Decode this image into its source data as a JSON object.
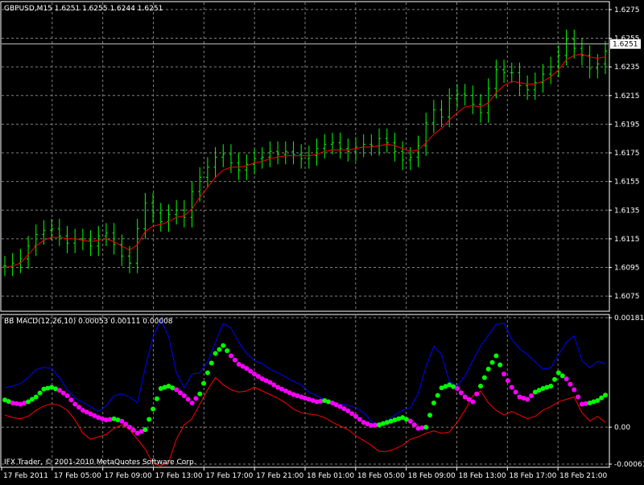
{
  "chart_data": [
    {
      "type": "candlestick",
      "title": "GBPUSD,M15  1.6251 1.6255 1.6244 1.6251",
      "current_price": 1.6251,
      "current_price_label": "1.6251",
      "ylim": [
        1.6065,
        1.628
      ],
      "y_ticks": [
        1.6275,
        1.6255,
        1.6235,
        1.6215,
        1.6195,
        1.6175,
        1.6155,
        1.6135,
        1.6115,
        1.6095,
        1.6075
      ],
      "y_tick_labels": [
        "1.6275",
        "1.6255",
        "1.6235",
        "1.6215",
        "1.6195",
        "1.6175",
        "1.6155",
        "1.6135",
        "1.6115",
        "1.6095",
        "1.6075"
      ],
      "grid": true,
      "series": [
        {
          "name": "Close",
          "color": "#00ff00",
          "values": [
            1.6096,
            1.6098,
            1.6101,
            1.611,
            1.6118,
            1.6121,
            1.6122,
            1.6117,
            1.6112,
            1.6115,
            1.6114,
            1.611,
            1.6117,
            1.6119,
            1.6111,
            1.6103,
            1.6098,
            1.6122,
            1.614,
            1.6133,
            1.6127,
            1.6132,
            1.6135,
            1.613,
            1.6148,
            1.6158,
            1.6165,
            1.6172,
            1.6174,
            1.6168,
            1.6163,
            1.6167,
            1.6171,
            1.6172,
            1.6176,
            1.6174,
            1.6176,
            1.6174,
            1.6171,
            1.6173,
            1.6178,
            1.6181,
            1.6182,
            1.6178,
            1.6176,
            1.6179,
            1.6181,
            1.618,
            1.6185,
            1.6182,
            1.6176,
            1.617,
            1.6172,
            1.618,
            1.6196,
            1.6205,
            1.62,
            1.6213,
            1.6216,
            1.6215,
            1.6209,
            1.6203,
            1.622,
            1.6233,
            1.6231,
            1.6231,
            1.6222,
            1.6219,
            1.6224,
            1.623,
            1.6235,
            1.6243,
            1.6254,
            1.6248,
            1.6243,
            1.6234,
            1.6237,
            1.6246
          ]
        },
        {
          "name": "MA",
          "color": "#ff0000",
          "values": [
            1.6095,
            1.6096,
            1.6098,
            1.6104,
            1.611,
            1.6114,
            1.6116,
            1.6116,
            1.6115,
            1.6115,
            1.6114,
            1.6113,
            1.6114,
            1.6115,
            1.6113,
            1.611,
            1.6107,
            1.6111,
            1.612,
            1.6124,
            1.6125,
            1.6127,
            1.613,
            1.6131,
            1.6136,
            1.6144,
            1.6151,
            1.6158,
            1.6163,
            1.6165,
            1.6165,
            1.6166,
            1.6168,
            1.6169,
            1.6171,
            1.6172,
            1.6173,
            1.6173,
            1.6173,
            1.6173,
            1.6174,
            1.6176,
            1.6177,
            1.6177,
            1.6177,
            1.6178,
            1.6179,
            1.6179,
            1.618,
            1.6181,
            1.618,
            1.6178,
            1.6176,
            1.6177,
            1.6182,
            1.6188,
            1.6192,
            1.6198,
            1.6203,
            1.6207,
            1.6208,
            1.6207,
            1.621,
            1.6217,
            1.6222,
            1.6225,
            1.6224,
            1.6223,
            1.6223,
            1.6225,
            1.6228,
            1.6233,
            1.624,
            1.6243,
            1.6244,
            1.6242,
            1.6241,
            1.6242
          ]
        }
      ]
    },
    {
      "type": "line",
      "title": "BB MACD(12,26,10) 0.00053 0.00111 0.00008",
      "ylim": [
        -0.00065,
        0.00185
      ],
      "y_ticks": [
        0.00181,
        0.0,
        -0.00061
      ],
      "y_tick_labels": [
        "0.00181",
        "0.00",
        "-0.00061"
      ],
      "grid": true,
      "series": [
        {
          "name": "Upper band",
          "color": "#0000ff",
          "values": [
            0.00065,
            0.00068,
            0.00072,
            0.00082,
            0.00095,
            0.00099,
            0.00097,
            0.00082,
            0.00062,
            0.00048,
            0.00041,
            0.00034,
            0.00026,
            0.00035,
            0.00052,
            0.00055,
            0.0005,
            0.0004,
            0.00098,
            0.00149,
            0.00178,
            0.0015,
            0.0009,
            0.00065,
            0.00088,
            0.0009,
            0.00108,
            0.0014,
            0.00172,
            0.00164,
            0.0014,
            0.00122,
            0.0011,
            0.00105,
            0.00096,
            0.0009,
            0.00083,
            0.00076,
            0.0007,
            0.00058,
            0.00052,
            0.00046,
            0.00042,
            0.00038,
            0.00036,
            0.00032,
            0.00024,
            0.0001,
            2e-05,
            0.0001,
            0.0002,
            0.00028,
            0.00032,
            0.00056,
            0.001,
            0.00134,
            0.0012,
            0.00075,
            0.00068,
            0.00085,
            0.0011,
            0.00134,
            0.00152,
            0.0017,
            0.00172,
            0.00145,
            0.0013,
            0.0012,
            0.00108,
            0.00096,
            0.00098,
            0.0012,
            0.0014,
            0.00151,
            0.0011,
            0.00098,
            0.00109,
            0.00105
          ]
        },
        {
          "name": "Lower band",
          "color": "#ff0000",
          "values": [
            0.0002,
            0.00016,
            0.00014,
            0.00018,
            0.00028,
            0.00035,
            0.00039,
            0.00036,
            0.00028,
            0.00012,
            -0.0001,
            -0.0002,
            -0.00016,
            -0.00012,
            -2e-05,
            4e-05,
            -4e-05,
            -0.0002,
            -0.00036,
            -0.0006,
            -0.00064,
            -0.00058,
            -0.0002,
            4e-05,
            0.00014,
            0.00038,
            0.00062,
            0.00082,
            0.0007,
            0.00062,
            0.00058,
            0.0006,
            0.00066,
            0.0006,
            0.00054,
            0.00048,
            0.0004,
            0.0003,
            0.00024,
            0.00022,
            0.0002,
            0.00016,
            8e-05,
            2e-05,
            -4e-05,
            -0.00014,
            -0.00022,
            -0.0003,
            -0.0004,
            -0.0004,
            -0.00036,
            -0.0003,
            -0.0002,
            -0.00016,
            -0.0001,
            -6e-05,
            -0.0001,
            -8e-05,
            8e-05,
            0.00028,
            0.00052,
            0.0006,
            0.0004,
            0.00028,
            0.0002,
            0.00026,
            0.0002,
            0.00014,
            0.00018,
            0.00028,
            0.00034,
            0.00042,
            0.00046,
            0.0005,
            0.00024,
            0.0001,
            0.00018,
            8e-05
          ]
        },
        {
          "name": "MACD",
          "color": "#ff00ff",
          "color_up": "#00ff00",
          "values": [
            0.00045,
            0.0004,
            0.00038,
            0.00042,
            0.0005,
            0.00063,
            0.00066,
            0.00061,
            0.00052,
            0.00038,
            0.00028,
            0.00022,
            0.00016,
            0.00012,
            0.00014,
            0.0001,
            0.0,
            -0.0001,
            -4e-05,
            0.0003,
            0.00064,
            0.00068,
            0.00062,
            0.00052,
            0.0004,
            0.00055,
            0.0009,
            0.00122,
            0.00135,
            0.00118,
            0.00104,
            0.00097,
            0.00088,
            0.0008,
            0.00074,
            0.00066,
            0.0006,
            0.00054,
            0.0005,
            0.00046,
            0.00042,
            0.00044,
            0.0004,
            0.00034,
            0.00027,
            0.00018,
            8e-05,
            3e-05,
            4e-05,
            8e-05,
            0.00012,
            0.00016,
            0.0001,
            -2e-05,
            0.0,
            0.0004,
            0.00065,
            0.0007,
            0.00064,
            0.0005,
            0.00042,
            0.00068,
            0.00096,
            0.00118,
            0.00088,
            0.00066,
            0.0005,
            0.00046,
            0.00058,
            0.00064,
            0.00068,
            0.0009,
            0.0008,
            0.00062,
            0.00038,
            0.0004,
            0.00044,
            0.00053
          ]
        }
      ]
    }
  ],
  "x_tick_labels": [
    "17 Feb 2011",
    "17 Feb 05:00",
    "17 Feb 09:00",
    "17 Feb 13:00",
    "17 Feb 17:00",
    "17 Feb 21:00",
    "18 Feb 01:00",
    "18 Feb 05:00",
    "18 Feb 09:00",
    "18 Feb 13:00",
    "18 Feb 17:00",
    "18 Feb 21:00"
  ],
  "copyright": "IFX Trader, © 2001-2010 MetaQuotes Software Corp.",
  "colors": {
    "background": "#000000",
    "grid": "#808080",
    "frame": "#ffffff",
    "bull": "#00ff00",
    "ma": "#ff0000",
    "band_upper": "#0000ff",
    "band_lower": "#ff0000",
    "macd_down": "#ff00ff",
    "macd_up": "#00ff00"
  }
}
